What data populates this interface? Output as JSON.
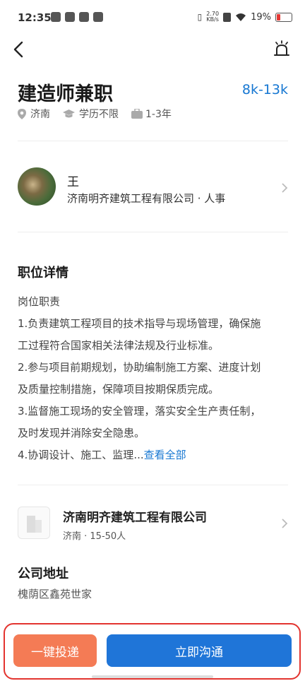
{
  "status_bar": {
    "time": "12:35",
    "speed_top": "2.70",
    "speed_bottom": "KB/s",
    "battery": "19%"
  },
  "job": {
    "title": "建造师兼职",
    "salary": "8k-13k",
    "location": "济南",
    "education": "学历不限",
    "experience": "1-3年"
  },
  "recruiter": {
    "name": "王",
    "company_role": "济南明齐建筑工程有限公司 · 人事"
  },
  "details": {
    "heading": "职位详情",
    "lines": [
      "岗位职责",
      "1.负责建筑工程项目的技术指导与现场管理，确保施",
      "工过程符合国家相关法律法规及行业标准。",
      "2.参与项目前期规划，协助编制施工方案、进度计划",
      "及质量控制措施，保障项目按期保质完成。",
      "3.监督施工现场的安全管理，落实安全生产责任制，",
      "及时发现并消除安全隐患。"
    ],
    "last_line": "4.协调设计、施工、监理...",
    "more_link": "查看全部"
  },
  "company": {
    "name": "济南明齐建筑工程有限公司",
    "info": "济南 · 15-50人"
  },
  "address": {
    "heading": "公司地址",
    "value": "槐荫区鑫苑世家"
  },
  "actions": {
    "apply": "一键投递",
    "chat": "立即沟通"
  },
  "colors": {
    "accent": "#1677d2",
    "apply_button": "#f47b55",
    "chat_button": "#1f75d8",
    "highlight_border": "#e3342f"
  }
}
